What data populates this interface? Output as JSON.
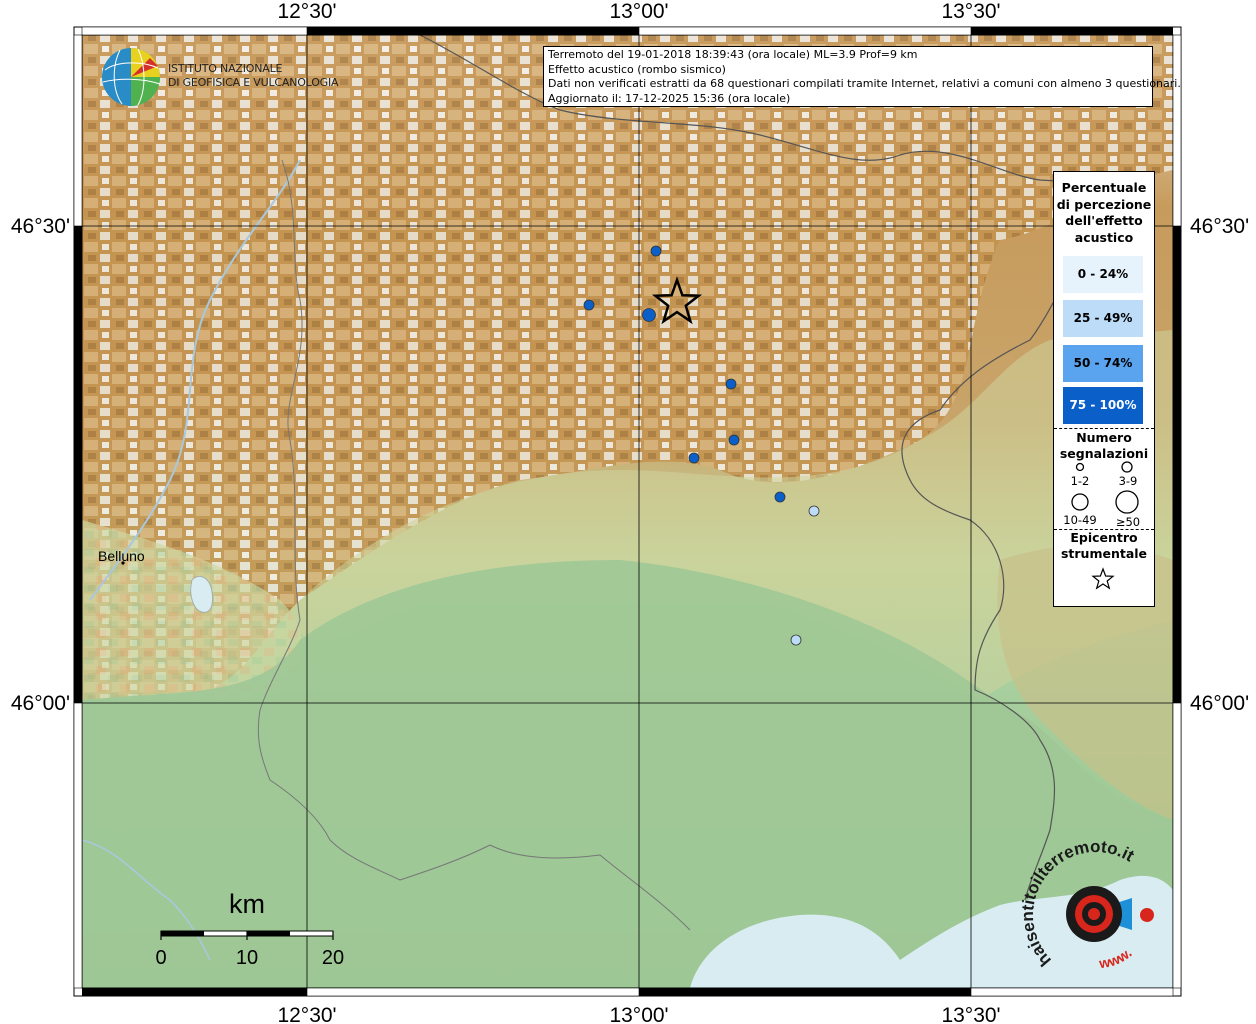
{
  "frame": {
    "top_ticks": [
      "12°30'",
      "13°00'",
      "13°30'"
    ],
    "bottom_ticks": [
      "12°30'",
      "13°00'",
      "13°30'"
    ],
    "left_ticks": [
      "46°30'",
      "46°00'"
    ],
    "right_ticks": [
      "46°30'",
      "46°00'"
    ]
  },
  "logo": {
    "line1": "ISTITUTO NAZIONALE",
    "line2": "DI GEOFISICA E VULCANOLOGIA"
  },
  "info": {
    "line1": "Terremoto del 19-01-2018 18:39:43 (ora locale) ML=3.9 Prof=9 km",
    "line2": "Effetto acustico (rombo sismico)",
    "line3": "Dati non verificati estratti da 68 questionari compilati tramite Internet, relativi a comuni con almeno 3 questionari.",
    "line4": "Aggiornato il: 17-12-2025 15:36 (ora locale)"
  },
  "legend": {
    "title_lines": [
      "Percentuale",
      "di percezione",
      "dell'effetto",
      "acustico"
    ],
    "classes": [
      {
        "label": "0 - 24%",
        "color": "#e6f2fc",
        "text_color": "#000000"
      },
      {
        "label": "25 - 49%",
        "color": "#bcdcf7",
        "text_color": "#000000"
      },
      {
        "label": "50 - 74%",
        "color": "#5aa3ee",
        "text_color": "#000000"
      },
      {
        "label": "75 - 100%",
        "color": "#0a5fc9",
        "text_color": "#ffffff"
      }
    ],
    "count_title_lines": [
      "Numero",
      "segnalazioni"
    ],
    "sizes": [
      "1-2",
      "3-9",
      "10-49",
      "≥50"
    ],
    "epicenter_title_lines": [
      "Epicentro",
      "strumentale"
    ]
  },
  "places": {
    "belluno": "Belluno"
  },
  "scale_bar": {
    "unit": "km",
    "labels": [
      "0",
      "10",
      "20"
    ]
  },
  "watermark": {
    "text": "haisentitoilterremoto.it",
    "url": "www."
  },
  "colors": {
    "plain": "#9cc796",
    "foothill": "#c9d39a",
    "mountain": "#b98b4a",
    "snow": "#f3f1ee",
    "border": "#666666",
    "sea": "#d8ecf2"
  },
  "points": [
    {
      "name": "point-1",
      "class": 3,
      "size": "1-2"
    },
    {
      "name": "point-2",
      "class": 3,
      "size": "1-2"
    },
    {
      "name": "point-3",
      "class": 3,
      "size": "3-9"
    },
    {
      "name": "point-4",
      "class": 3,
      "size": "1-2"
    },
    {
      "name": "point-5",
      "class": 3,
      "size": "1-2"
    },
    {
      "name": "point-6",
      "class": 3,
      "size": "1-2"
    },
    {
      "name": "point-7",
      "class": 3,
      "size": "1-2"
    },
    {
      "name": "point-8",
      "class": 1,
      "size": "1-2"
    },
    {
      "name": "point-9",
      "class": 1,
      "size": "1-2"
    }
  ]
}
